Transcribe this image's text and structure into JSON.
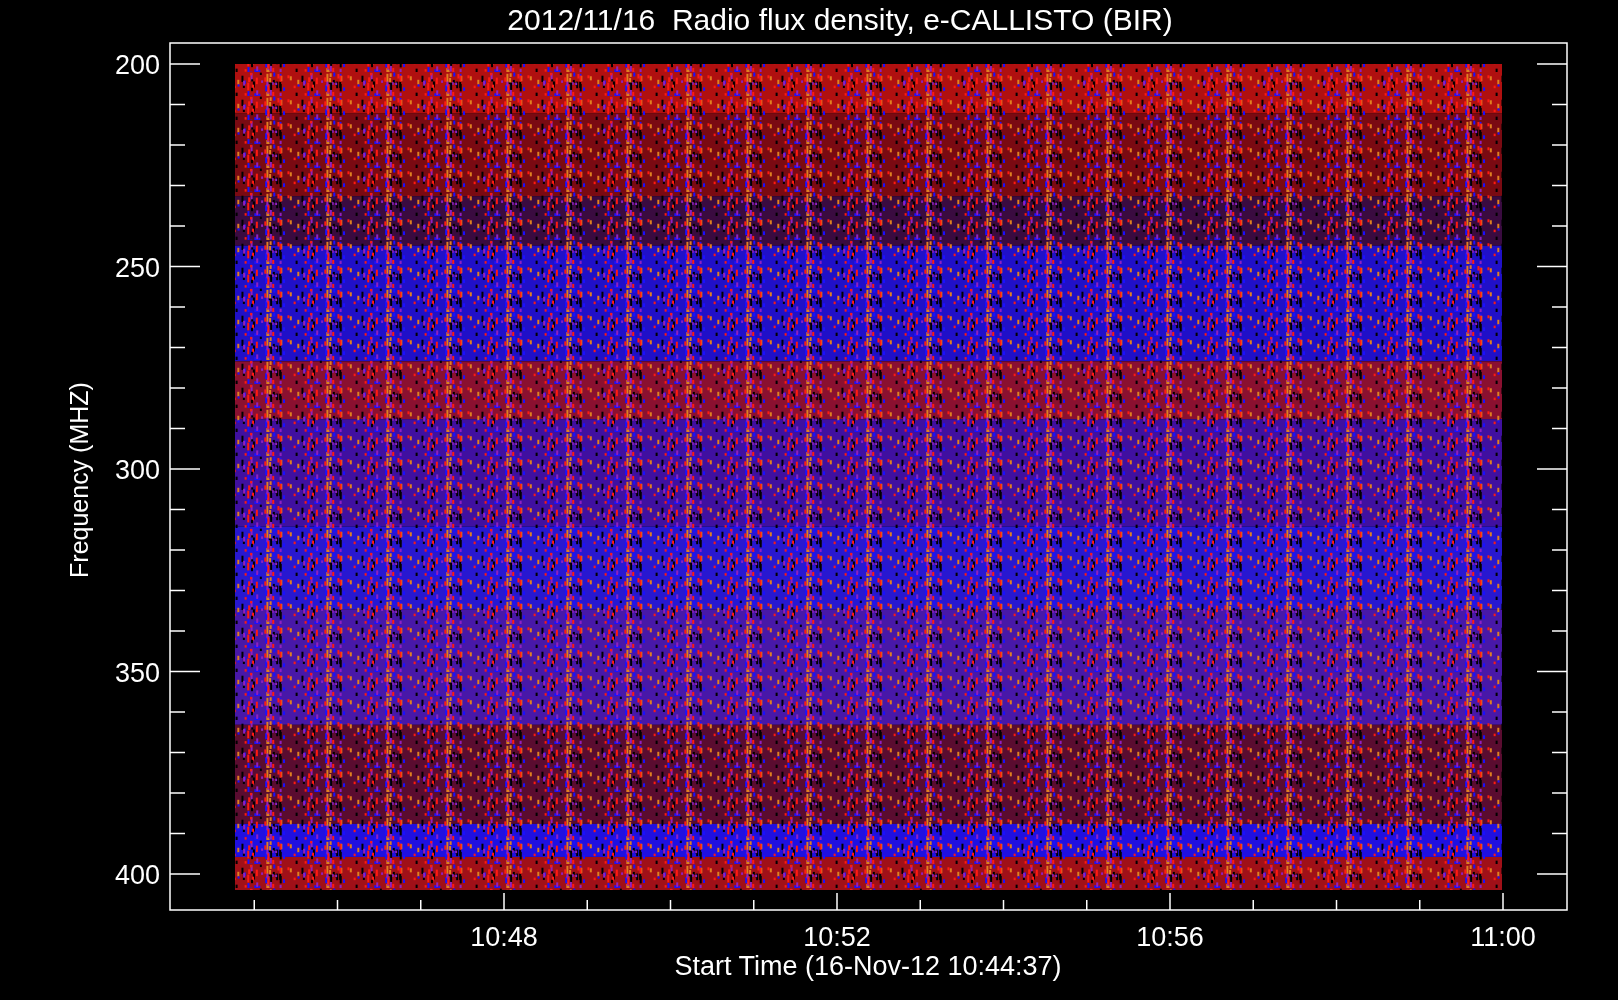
{
  "title": "2012/11/16  Radio flux density, e-CALLISTO (BIR)",
  "y_axis": {
    "label": "Frequency (MHZ)",
    "ticks": [
      "200",
      "250",
      "300",
      "350",
      "400"
    ]
  },
  "x_axis": {
    "label": "Start Time (16-Nov-12 10:44:37)",
    "ticks": [
      "10:48",
      "10:52",
      "10:56",
      "11:00"
    ]
  }
}
